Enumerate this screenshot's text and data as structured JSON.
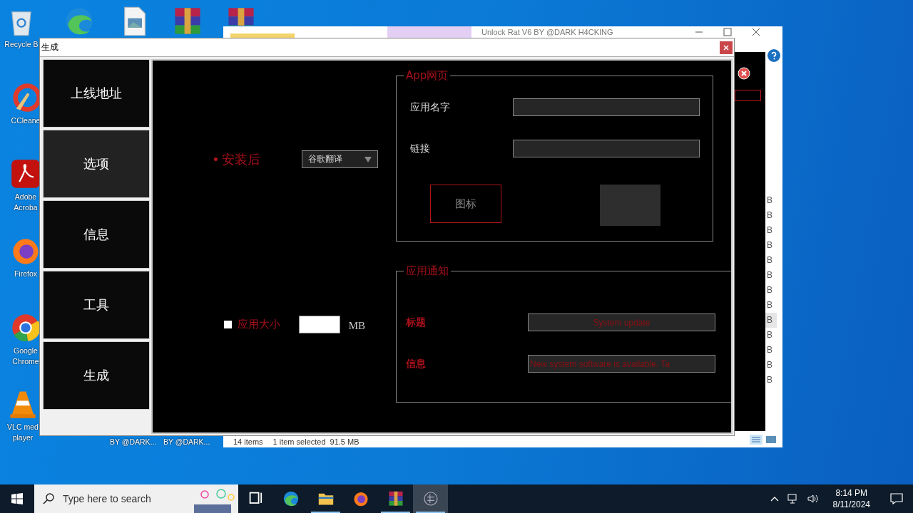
{
  "desktop": {
    "icons": [
      {
        "kind": "recycle-bin",
        "label": [
          "Recycle B"
        ]
      },
      {
        "kind": "edge"
      },
      {
        "kind": "image-file"
      },
      {
        "kind": "archive"
      },
      {
        "kind": "archive"
      },
      {
        "kind": "ccleaner",
        "label": [
          "CCleane"
        ]
      },
      {
        "kind": "acrobat",
        "label": [
          "Adobe",
          "Acroba"
        ]
      },
      {
        "kind": "firefox",
        "label": [
          "Firefox"
        ]
      },
      {
        "kind": "chrome",
        "label": [
          "Google",
          "Chrome"
        ]
      },
      {
        "kind": "vlc",
        "label": [
          "VLC med",
          "player"
        ]
      }
    ],
    "covered_labels": [
      "BY @DARK...",
      "BY @DARK..."
    ]
  },
  "explorer": {
    "title": "Unlock Rat V6 BY @DARK H4CKING",
    "size_column": [
      {
        "text": "B",
        "selected": false
      },
      {
        "text": "B",
        "selected": false
      },
      {
        "text": "B",
        "selected": false
      },
      {
        "text": "B",
        "selected": false
      },
      {
        "text": "B",
        "selected": false
      },
      {
        "text": "B",
        "selected": false
      },
      {
        "text": "B",
        "selected": false
      },
      {
        "text": "B",
        "selected": false
      },
      {
        "text": "B",
        "selected": true
      },
      {
        "text": "B",
        "selected": false
      },
      {
        "text": "B",
        "selected": false
      },
      {
        "text": "B",
        "selected": false
      },
      {
        "text": "B",
        "selected": false
      }
    ],
    "status": {
      "count": "14 items",
      "selection": "1 item selected",
      "size": "91.5 MB"
    }
  },
  "dialog": {
    "title": "生成",
    "nav": [
      {
        "label": "上线地址",
        "selected": false
      },
      {
        "label": "选项",
        "selected": true
      },
      {
        "label": "信息",
        "selected": false
      },
      {
        "label": "工具",
        "selected": false
      },
      {
        "label": "生成",
        "selected": false
      }
    ],
    "after_install": {
      "label": "安装后",
      "value": "谷歌翻译"
    },
    "app_size": {
      "label": "应用大小",
      "checked": false,
      "unit": "MB"
    },
    "app_page": {
      "title": "App网页",
      "name_label": "应用名字",
      "link_label": "链接",
      "icon_button": "图标"
    },
    "notification": {
      "title": "应用通知",
      "title_label": "标题",
      "title_value": "System update",
      "message_label": "信息",
      "message_value": "New system software is available. Ta"
    }
  },
  "taskbar": {
    "search_placeholder": "Type here to search",
    "apps": [
      {
        "kind": "task-view",
        "running": false,
        "selected": false
      },
      {
        "kind": "edge",
        "running": false,
        "selected": false
      },
      {
        "kind": "folder",
        "running": true,
        "selected": false
      },
      {
        "kind": "firefox",
        "running": false,
        "selected": false
      },
      {
        "kind": "archive",
        "running": true,
        "selected": false
      },
      {
        "kind": "app",
        "running": true,
        "selected": true
      }
    ],
    "time": "8:14 PM",
    "date": "8/11/2024"
  }
}
